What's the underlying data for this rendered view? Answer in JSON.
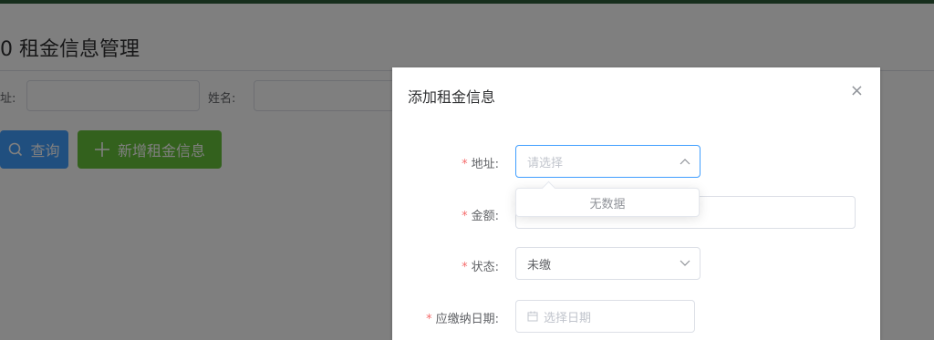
{
  "page": {
    "title": "0 租金信息管理",
    "filters": [
      {
        "label": "址:"
      },
      {
        "label": "姓名:"
      }
    ],
    "buttons": {
      "query": "查询",
      "add": "新增租金信息"
    }
  },
  "dialog": {
    "title": "添加租金信息",
    "close": "×",
    "fields": {
      "address": {
        "label": "地址:",
        "placeholder": "请选择",
        "dropdown_empty": "无数据"
      },
      "amount": {
        "label": "金额:"
      },
      "status": {
        "label": "状态:",
        "value": "未缴"
      },
      "due_date": {
        "label": "应缴纳日期:",
        "placeholder": "选择日期"
      }
    },
    "required_mark": "*"
  },
  "colors": {
    "primary": "#409eff",
    "success": "#67c23a",
    "danger": "#f56c6c"
  }
}
